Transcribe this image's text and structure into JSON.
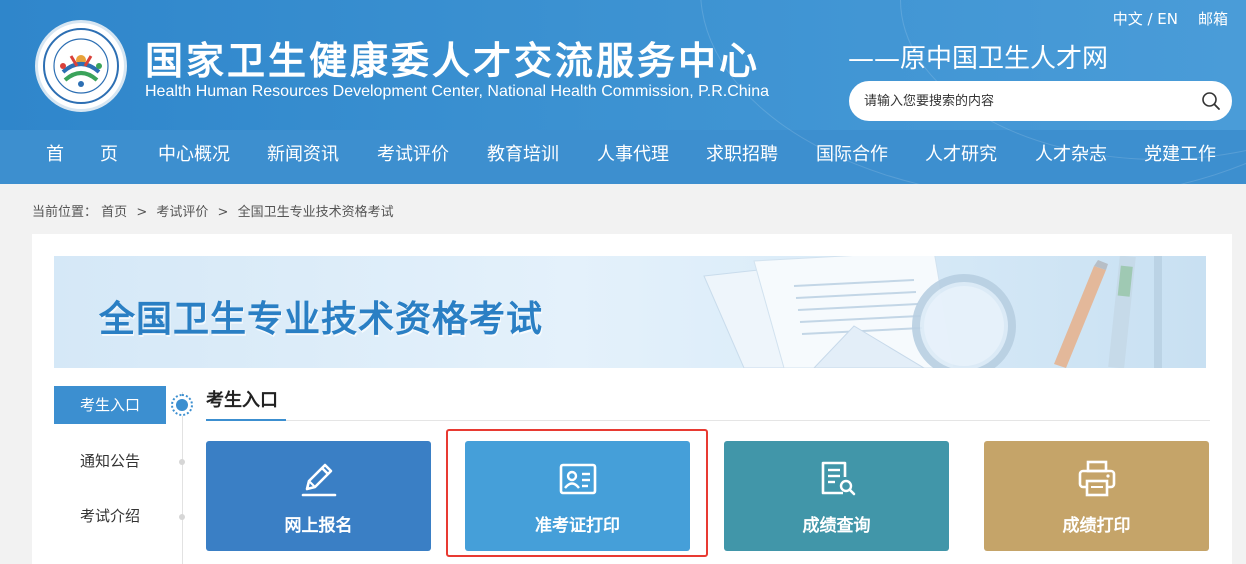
{
  "header": {
    "title": "国家卫生健康委人才交流服务中心",
    "subtitle_en": "Health Human Resources Development Center, National Health Commission, P.R.China",
    "former_name": "——原中国卫生人才网",
    "lang_switch": "中文 / EN",
    "mail": "邮箱",
    "search_placeholder": "请输入您要搜索的内容"
  },
  "nav": {
    "items": [
      "首　　页",
      "中心概况",
      "新闻资讯",
      "考试评价",
      "教育培训",
      "人事代理",
      "求职招聘",
      "国际合作",
      "人才研究",
      "人才杂志",
      "党建工作"
    ]
  },
  "breadcrumb": {
    "prefix": "当前位置：",
    "items": [
      "首页",
      "考试评价",
      "全国卫生专业技术资格考试"
    ],
    "separator": ">"
  },
  "banner": {
    "title": "全国卫生专业技术资格考试"
  },
  "sidebar": {
    "items": [
      "考生入口",
      "通知公告",
      "考试介绍"
    ],
    "active": "考生入口"
  },
  "section": {
    "title": "考生入口"
  },
  "cards": [
    {
      "label": "网上报名",
      "icon": "pencil-icon",
      "color": "#3a7fc5"
    },
    {
      "label": "准考证打印",
      "icon": "id-card-icon",
      "color": "#459fd9"
    },
    {
      "label": "成绩查询",
      "icon": "document-search-icon",
      "color": "#4196a9"
    },
    {
      "label": "成绩打印",
      "icon": "printer-icon",
      "color": "#c5a469"
    }
  ],
  "colors": {
    "header_blue": "#3d8fcf",
    "accent": "#3c8fd0",
    "highlight": "#e83a32"
  }
}
